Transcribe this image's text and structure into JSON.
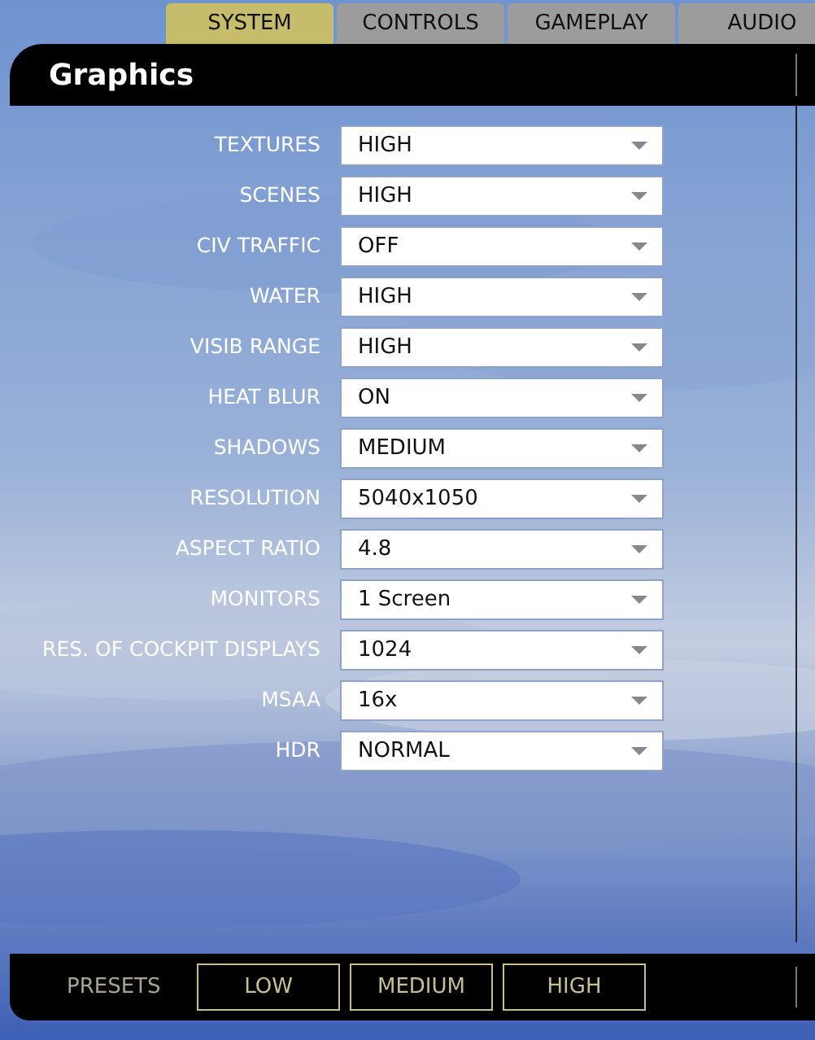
{
  "tabs": [
    {
      "label": "SYSTEM",
      "selected": true
    },
    {
      "label": "CONTROLS",
      "selected": false
    },
    {
      "label": "GAMEPLAY",
      "selected": false
    },
    {
      "label": "AUDIO",
      "selected": false
    }
  ],
  "panel": {
    "title": "Graphics"
  },
  "settings": [
    {
      "label": "TEXTURES",
      "value": "HIGH"
    },
    {
      "label": "SCENES",
      "value": "HIGH"
    },
    {
      "label": "CIV TRAFFIC",
      "value": "OFF"
    },
    {
      "label": "WATER",
      "value": "HIGH"
    },
    {
      "label": "VISIB RANGE",
      "value": "HIGH"
    },
    {
      "label": "HEAT BLUR",
      "value": "ON"
    },
    {
      "label": "SHADOWS",
      "value": "MEDIUM"
    },
    {
      "label": "RESOLUTION",
      "value": "5040x1050"
    },
    {
      "label": "ASPECT RATIO",
      "value": "4.8"
    },
    {
      "label": "MONITORS",
      "value": "1 Screen"
    },
    {
      "label": "RES. OF COCKPIT DISPLAYS",
      "value": "1024"
    },
    {
      "label": "MSAA",
      "value": "16x"
    },
    {
      "label": "HDR",
      "value": "NORMAL"
    }
  ],
  "presets": {
    "label": "PRESETS",
    "buttons": [
      "LOW",
      "MEDIUM",
      "HIGH"
    ]
  }
}
